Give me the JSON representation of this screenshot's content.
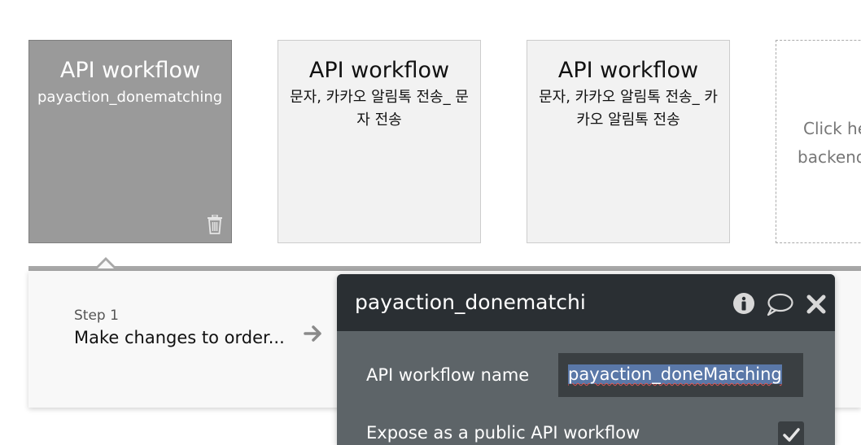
{
  "workflows": [
    {
      "title": "API workflow",
      "subtitle": "payaction_donematching",
      "active": true
    },
    {
      "title": "API workflow",
      "subtitle": "문자, 카카오 알림톡 전송_ 문자 전송",
      "active": false
    },
    {
      "title": "API workflow",
      "subtitle": "문자, 카카오 알림톡 전송_ 카카오 알림톡 전송",
      "active": false
    }
  ],
  "add_card": {
    "line1": "Click here to add a",
    "line2": "backend workflow"
  },
  "steps": [
    {
      "label": "Step 1",
      "title": "Make changes to order..."
    }
  ],
  "panel": {
    "title": "payaction_donematching",
    "name_label": "API workflow name",
    "name_value": "payaction_doneMatching",
    "expose_label": "Expose as a public API workflow",
    "expose_checked": true
  },
  "colors": {
    "active_card": "#9a9a9a",
    "panel_header": "#2a2f33",
    "panel_body": "#5d6468",
    "selection": "#5a78a8"
  }
}
